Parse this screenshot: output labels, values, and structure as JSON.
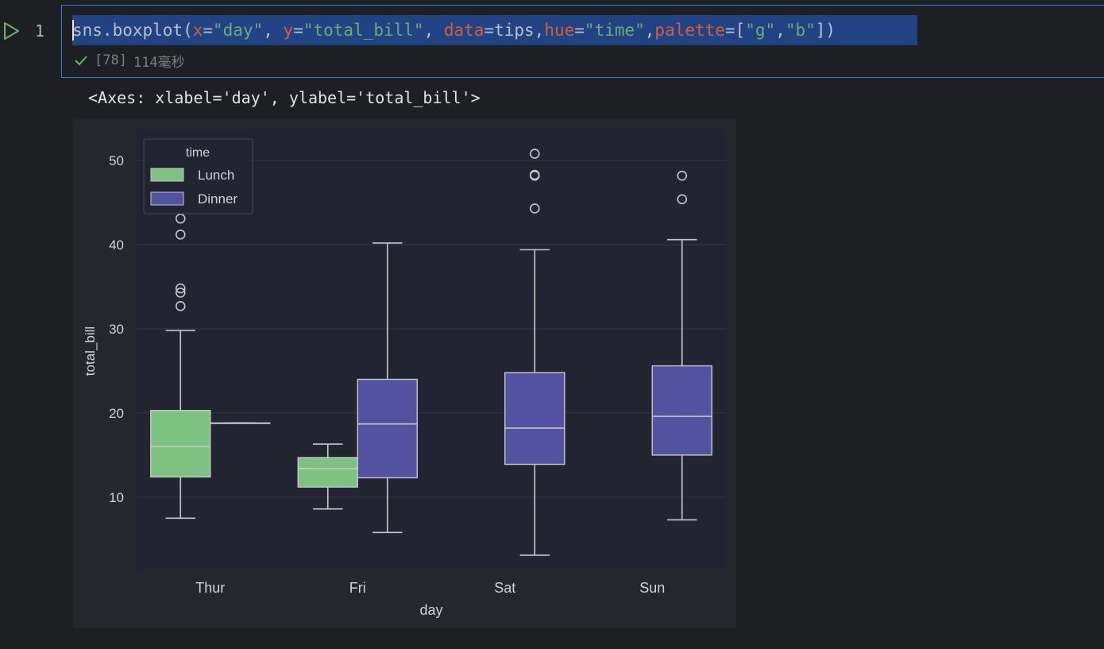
{
  "cell": {
    "line_number": "1",
    "code_tokens": [
      {
        "t": "sns.boxplot(",
        "c": "def"
      },
      {
        "t": "x",
        "c": "param"
      },
      {
        "t": "=",
        "c": "def"
      },
      {
        "t": "\"day\"",
        "c": "str"
      },
      {
        "t": ", ",
        "c": "def"
      },
      {
        "t": "y",
        "c": "param"
      },
      {
        "t": "=",
        "c": "def"
      },
      {
        "t": "\"total_bill\"",
        "c": "str"
      },
      {
        "t": ", ",
        "c": "def"
      },
      {
        "t": "data",
        "c": "param"
      },
      {
        "t": "=tips,",
        "c": "def"
      },
      {
        "t": "hue",
        "c": "param"
      },
      {
        "t": "=",
        "c": "def"
      },
      {
        "t": "\"time\"",
        "c": "str"
      },
      {
        "t": ",",
        "c": "def"
      },
      {
        "t": "palette",
        "c": "param"
      },
      {
        "t": "=[",
        "c": "def"
      },
      {
        "t": "\"g\"",
        "c": "str"
      },
      {
        "t": ",",
        "c": "def"
      },
      {
        "t": "\"b\"",
        "c": "str"
      },
      {
        "t": "])",
        "c": "def"
      }
    ],
    "exec_count": "[78]",
    "exec_time": "114毫秒"
  },
  "output": {
    "repr": "<Axes: xlabel='day', ylabel='total_bill'>"
  },
  "colors": {
    "lunch": "#7ec282",
    "dinner": "#5252a0",
    "plot_bg": "#232431",
    "figure_bg": "#26272d",
    "text": "#d3d3d3",
    "whisker": "#c8c8c8"
  },
  "chart_data": {
    "type": "boxplot",
    "xlabel": "day",
    "ylabel": "total_bill",
    "categories": [
      "Thur",
      "Fri",
      "Sat",
      "Sun"
    ],
    "yticks": [
      10,
      20,
      30,
      40,
      50
    ],
    "ylim": [
      1.3,
      53.5
    ],
    "grid": true,
    "legend": {
      "title": "time",
      "placement": "top-left",
      "entries": [
        "Lunch",
        "Dinner"
      ]
    },
    "series": [
      {
        "name": "Lunch",
        "boxes": [
          {
            "category": "Thur",
            "whislo": 7.5,
            "q1": 12.4,
            "med": 16.0,
            "q3": 20.3,
            "whishi": 29.8,
            "fliers": [
              32.7,
              34.3,
              34.8,
              41.2,
              43.1
            ]
          },
          {
            "category": "Fri",
            "whislo": 8.6,
            "q1": 11.2,
            "med": 13.4,
            "q3": 14.7,
            "whishi": 16.3,
            "fliers": []
          },
          {
            "category": "Sat",
            "empty": true
          },
          {
            "category": "Sun",
            "empty": true
          }
        ]
      },
      {
        "name": "Dinner",
        "boxes": [
          {
            "category": "Thur",
            "whislo": 18.8,
            "q1": 18.8,
            "med": 18.8,
            "q3": 18.8,
            "whishi": 18.8,
            "fliers": []
          },
          {
            "category": "Fri",
            "whislo": 5.8,
            "q1": 12.3,
            "med": 18.7,
            "q3": 24.0,
            "whishi": 40.2,
            "fliers": []
          },
          {
            "category": "Sat",
            "whislo": 3.1,
            "q1": 13.9,
            "med": 18.2,
            "q3": 24.8,
            "whishi": 39.4,
            "fliers": [
              44.3,
              48.3,
              48.2,
              50.8
            ]
          },
          {
            "category": "Sun",
            "whislo": 7.3,
            "q1": 15.0,
            "med": 19.6,
            "q3": 25.6,
            "whishi": 40.6,
            "fliers": [
              45.4,
              48.2
            ]
          }
        ]
      }
    ]
  }
}
